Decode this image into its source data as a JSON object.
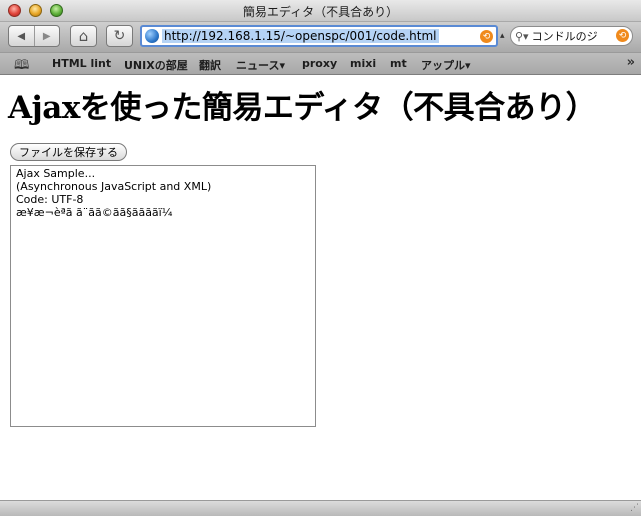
{
  "window": {
    "title": "簡易エディタ（不具合あり）"
  },
  "toolbar": {
    "back_icon": "◀",
    "forward_icon": "▶",
    "home_icon": "⌂",
    "reload_icon": "↻",
    "address_url": "http://192.168.1.15/~openspc/001/code.html",
    "search_text": "コンドルのジ",
    "rss_icon": "⟲"
  },
  "bookmarks": {
    "items": [
      {
        "label": "HTML lint"
      },
      {
        "label": "UNIXの部屋"
      },
      {
        "label": "翻訳"
      },
      {
        "label": "ニュース▾"
      },
      {
        "label": "proxy"
      },
      {
        "label": "mixi"
      },
      {
        "label": "mt"
      },
      {
        "label": "アップル▾"
      }
    ],
    "more_icon": "»"
  },
  "page": {
    "title": "Ajaxを使った簡易エディタ（不具合あり）",
    "save_button_label": "ファイルを保存する",
    "editor_text": "Ajax Sample...\n(Asynchronous JavaScript and XML)\nCode: UTF-8\næ¥æ¬èªã ã¨ãã©ãã§ããããï¼"
  },
  "colors": {
    "address_focus": "#5a8ad4",
    "url_selection": "#b5d3f5",
    "rss_orange": "#f08a1c"
  }
}
